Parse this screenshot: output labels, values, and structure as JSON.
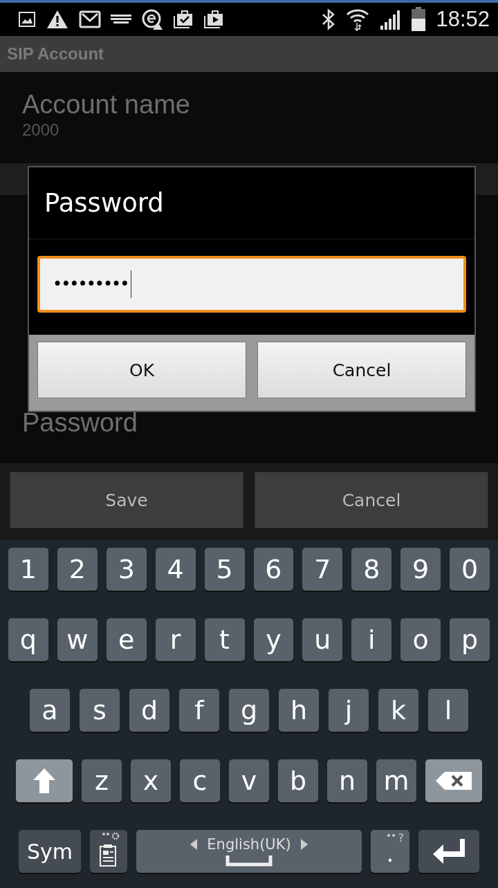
{
  "status_bar": {
    "time": "18:52"
  },
  "title": "SIP Account",
  "settings": [
    {
      "label": "Account name",
      "value": "2000"
    },
    {
      "label": "Password"
    }
  ],
  "dialog": {
    "title": "Password",
    "field": {
      "value": "•••••••••",
      "focused": true
    },
    "buttons": [
      "OK",
      "Cancel"
    ]
  },
  "actions": [
    "Save",
    "Cancel"
  ],
  "keyboard": [
    [
      {
        "kind": "char",
        "label": "1"
      },
      {
        "kind": "char",
        "label": "2"
      },
      {
        "kind": "char",
        "label": "3"
      },
      {
        "kind": "char",
        "label": "4"
      },
      {
        "kind": "char",
        "label": "5"
      },
      {
        "kind": "char",
        "label": "6"
      },
      {
        "kind": "char",
        "label": "7"
      },
      {
        "kind": "char",
        "label": "8"
      },
      {
        "kind": "char",
        "label": "9"
      },
      {
        "kind": "char",
        "label": "0"
      }
    ],
    [
      {
        "kind": "char",
        "label": "q"
      },
      {
        "kind": "char",
        "label": "w"
      },
      {
        "kind": "char",
        "label": "e"
      },
      {
        "kind": "char",
        "label": "r"
      },
      {
        "kind": "char",
        "label": "t"
      },
      {
        "kind": "char",
        "label": "y"
      },
      {
        "kind": "char",
        "label": "u"
      },
      {
        "kind": "char",
        "label": "i"
      },
      {
        "kind": "char",
        "label": "o"
      },
      {
        "kind": "char",
        "label": "p"
      }
    ],
    [
      {
        "kind": "char",
        "label": "a"
      },
      {
        "kind": "char",
        "label": "s"
      },
      {
        "kind": "char",
        "label": "d"
      },
      {
        "kind": "char",
        "label": "f"
      },
      {
        "kind": "char",
        "label": "g"
      },
      {
        "kind": "char",
        "label": "h"
      },
      {
        "kind": "char",
        "label": "j"
      },
      {
        "kind": "char",
        "label": "k"
      },
      {
        "kind": "char",
        "label": "l"
      }
    ],
    [
      {
        "kind": "shift"
      },
      {
        "kind": "char",
        "label": "z"
      },
      {
        "kind": "char",
        "label": "x"
      },
      {
        "kind": "char",
        "label": "c"
      },
      {
        "kind": "char",
        "label": "v"
      },
      {
        "kind": "char",
        "label": "b"
      },
      {
        "kind": "char",
        "label": "n"
      },
      {
        "kind": "char",
        "label": "m"
      },
      {
        "kind": "backspace"
      }
    ],
    [
      {
        "kind": "sym",
        "label": "Sym"
      },
      {
        "kind": "clipboard"
      },
      {
        "kind": "space",
        "label": "English(UK)"
      },
      {
        "kind": "period",
        "label": ".",
        "hint": "?"
      },
      {
        "kind": "enter"
      }
    ]
  ]
}
